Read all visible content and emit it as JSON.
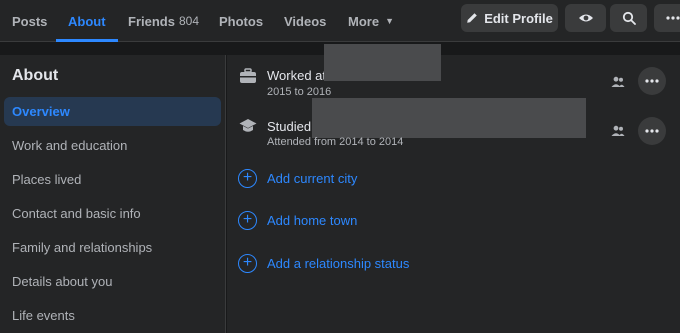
{
  "nav": {
    "tabs": [
      {
        "label": "Posts"
      },
      {
        "label": "About"
      },
      {
        "label": "Friends",
        "count": "804"
      },
      {
        "label": "Photos"
      },
      {
        "label": "Videos"
      },
      {
        "label": "More"
      }
    ],
    "edit_profile_label": "Edit Profile"
  },
  "sidebar": {
    "title": "About",
    "items": [
      {
        "label": "Overview"
      },
      {
        "label": "Work and education"
      },
      {
        "label": "Places lived"
      },
      {
        "label": "Contact and basic info"
      },
      {
        "label": "Family and relationships"
      },
      {
        "label": "Details about you"
      },
      {
        "label": "Life events"
      }
    ]
  },
  "overview": {
    "work": {
      "label": "Worked at",
      "dates": "2015 to 2016"
    },
    "education": {
      "label": "Studied",
      "dates": "Attended from 2014 to 2014"
    },
    "add_items": [
      {
        "label": "Add current city"
      },
      {
        "label": "Add home town"
      },
      {
        "label": "Add a relationship status"
      }
    ]
  },
  "colors": {
    "accent": "#2d88ff",
    "background": "#18191a",
    "panel": "#242526"
  },
  "icons": [
    "pencil-icon",
    "eye-icon",
    "search-icon",
    "more-icon",
    "briefcase-icon",
    "graduation-cap-icon",
    "friends-audience-icon",
    "plus-circle-icon",
    "caret-down-icon"
  ]
}
